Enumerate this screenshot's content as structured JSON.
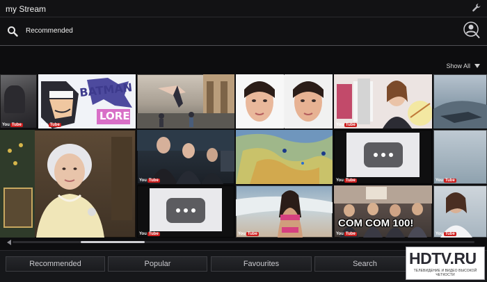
{
  "header": {
    "title": "my Stream",
    "settings_icon": "wrench-icon"
  },
  "search": {
    "value": "Recommended",
    "icon": "search-icon",
    "user_icon": "user-search-icon"
  },
  "show_all": {
    "label": "Show All",
    "icon": "triangle-down-icon"
  },
  "tiles": [
    {
      "caption": "",
      "badge": "You Tube"
    },
    {
      "caption": "LORE",
      "badge": "You Tube"
    },
    {
      "caption": "",
      "badge": ""
    },
    {
      "caption": "",
      "badge": ""
    },
    {
      "caption": "",
      "badge": "You Tube"
    },
    {
      "caption": "",
      "badge": ""
    },
    {
      "caption": "",
      "badge": ""
    },
    {
      "caption": "",
      "badge": "You Tube"
    },
    {
      "caption": "",
      "badge": ""
    },
    {
      "caption": "",
      "badge": "You Tube"
    },
    {
      "caption": "",
      "badge": "You Tube"
    },
    {
      "caption": "",
      "badge": "You Tube"
    },
    {
      "caption": "",
      "badge": "You Tube"
    },
    {
      "caption": "",
      "badge": "You Tube"
    },
    {
      "caption": "COM COM 100!",
      "badge": "You Tube"
    },
    {
      "caption": "",
      "badge": "You Tube"
    }
  ],
  "tabs": [
    "Recommended",
    "Popular",
    "Favourites",
    "Search"
  ],
  "watermark": {
    "main": "HDTV.RU",
    "sub": "ТЕЛЕВИДЕНИЕ И ВИДЕО ВЫСОКОЙ ЧЕТКОСТИ"
  },
  "colors": {
    "accent_yt": "#cc1f1f",
    "background": "#0d0d0f"
  }
}
